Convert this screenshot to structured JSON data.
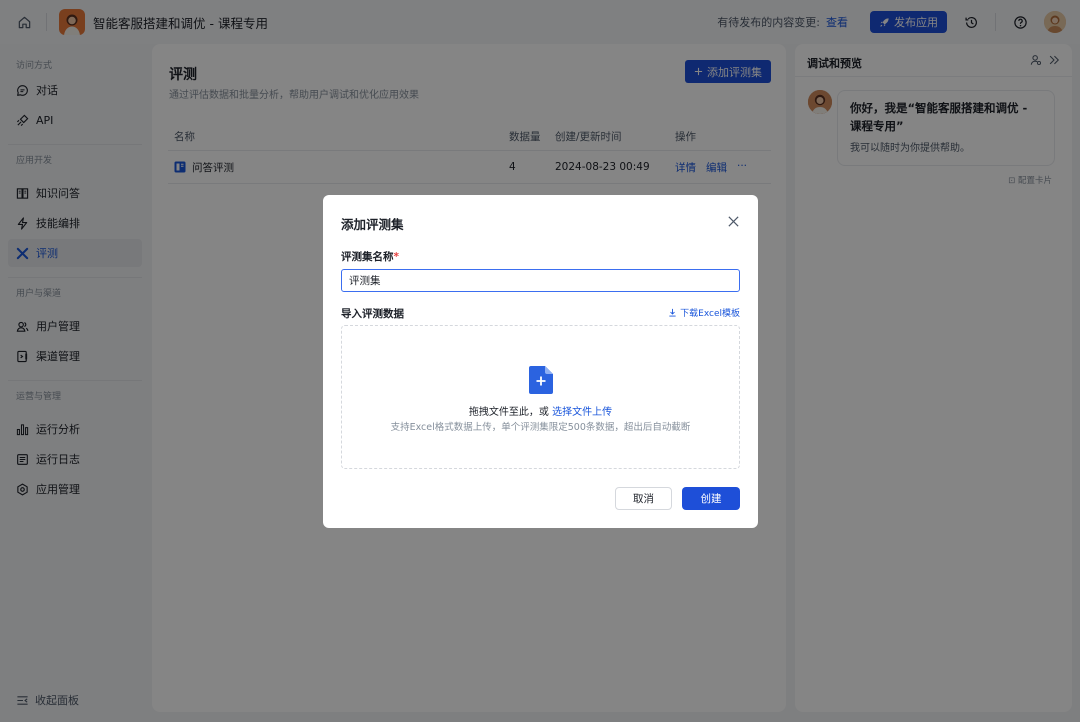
{
  "topbar": {
    "app_title": "智能客服搭建和调优 - 课程专用",
    "pending_text": "有待发布的内容变更:",
    "pending_link": "查看",
    "publish_label": "发布应用"
  },
  "sidebar": {
    "groups": [
      {
        "title": "访问方式",
        "items": [
          {
            "label": "对话",
            "icon": "chat-icon"
          },
          {
            "label": "API",
            "icon": "api-icon"
          }
        ]
      },
      {
        "title": "应用开发",
        "items": [
          {
            "label": "知识问答",
            "icon": "book-icon"
          },
          {
            "label": "技能编排",
            "icon": "lightning-icon"
          },
          {
            "label": "评测",
            "icon": "evaluation-icon"
          }
        ]
      },
      {
        "title": "用户与渠道",
        "items": [
          {
            "label": "用户管理",
            "icon": "users-icon"
          },
          {
            "label": "渠道管理",
            "icon": "channel-icon"
          }
        ]
      },
      {
        "title": "运营与管理",
        "items": [
          {
            "label": "运行分析",
            "icon": "bar-chart-icon"
          },
          {
            "label": "运行日志",
            "icon": "log-icon"
          },
          {
            "label": "应用管理",
            "icon": "gear-icon"
          }
        ]
      }
    ],
    "active": "评测",
    "collapse_label": "收起面板"
  },
  "main": {
    "title": "评测",
    "subtitle": "通过评估数据和批量分析，帮助用户调试和优化应用效果",
    "add_button": "添加评测集",
    "table": {
      "headers": [
        "名称",
        "数据量",
        "创建/更新时间",
        "操作"
      ],
      "rows": [
        {
          "name": "问答评测",
          "count": "4",
          "time": "2024-08-23 00:49",
          "ops": [
            "详情",
            "编辑",
            "···"
          ]
        }
      ]
    }
  },
  "preview": {
    "title": "调试和预览",
    "greeting_title": "你好，我是“智能客服搭建和调优 - 课程专用”",
    "greeting_text": "我可以随时为你提供帮助。",
    "config_card": "配置卡片"
  },
  "modal": {
    "title": "添加评测集",
    "name_label": "评测集名称",
    "required_mark": "*",
    "name_value": "评测集",
    "import_label": "导入评测数据",
    "download_link": "下载Excel模板",
    "drop_text": "拖拽文件至此，或",
    "drop_link": "选择文件上传",
    "drop_hint": "支持Excel格式数据上传，单个评测集限定500条数据，超出后自动截断",
    "cancel_label": "取消",
    "create_label": "创建"
  },
  "colors": {
    "primary": "#1e4fd8",
    "link": "#1a56db",
    "required": "#e53e3e"
  }
}
